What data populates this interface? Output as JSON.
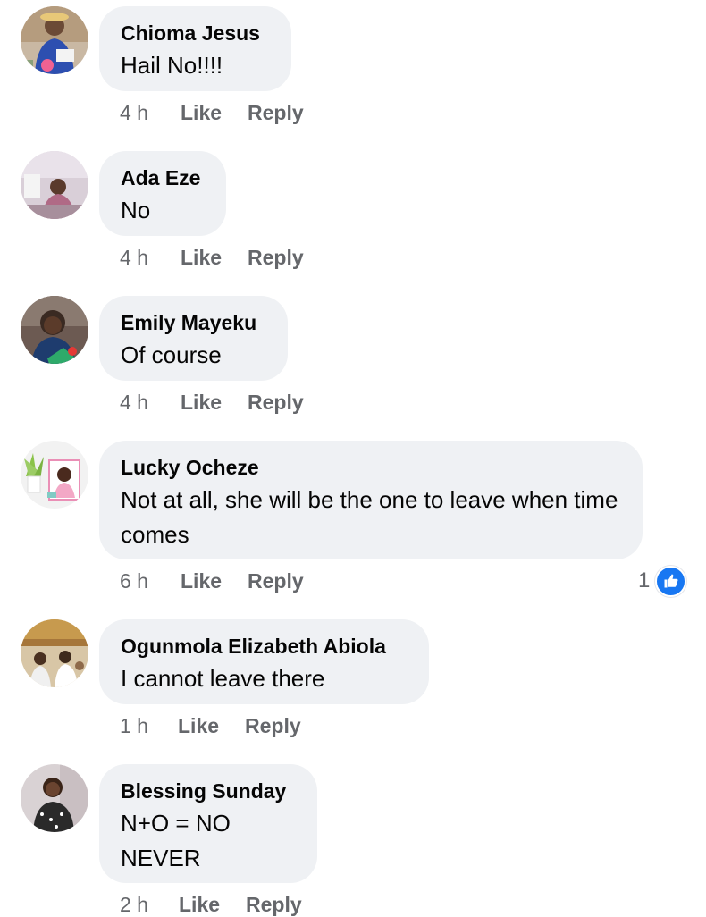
{
  "comments": [
    {
      "author": "Chioma Jesus",
      "text": "Hail No!!!!",
      "time": "4 h",
      "like_label": "Like",
      "reply_label": "Reply"
    },
    {
      "author": "Ada Eze",
      "text": "No",
      "time": "4 h",
      "like_label": "Like",
      "reply_label": "Reply"
    },
    {
      "author": "Emily Mayeku",
      "text": "Of course",
      "time": "4 h",
      "like_label": "Like",
      "reply_label": "Reply"
    },
    {
      "author": "Lucky Ocheze",
      "text": "Not at all, she will be the one to leave when time comes",
      "time": "6 h",
      "like_label": "Like",
      "reply_label": "Reply",
      "reaction_count": "1",
      "reaction_icon": "thumbs-up-icon"
    },
    {
      "author": "Ogunmola Elizabeth Abiola",
      "text": "I cannot leave there",
      "time": "1 h",
      "like_label": "Like",
      "reply_label": "Reply"
    },
    {
      "author": "Blessing Sunday",
      "text": "N+O = NO\nNEVER",
      "time": "2 h",
      "like_label": "Like",
      "reply_label": "Reply"
    }
  ],
  "colors": {
    "bubble_bg": "#eff1f4",
    "meta_text": "#65676b",
    "like_reaction": "#1877f2"
  }
}
